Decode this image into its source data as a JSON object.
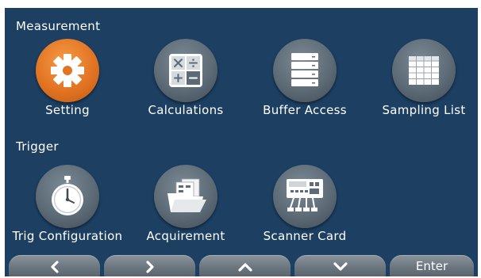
{
  "sections": {
    "measurement": "Measurement",
    "trigger": "Trigger"
  },
  "tiles": {
    "setting": {
      "label": "Setting",
      "icon": "gear-icon"
    },
    "calculations": {
      "label": "Calculations",
      "icon": "calculator-icon"
    },
    "buffer_access": {
      "label": "Buffer Access",
      "icon": "buffer-stack-icon"
    },
    "sampling_list": {
      "label": "Sampling List",
      "icon": "table-icon"
    },
    "trig_configuration": {
      "label": "Trig Configuration",
      "icon": "stopwatch-icon"
    },
    "acquirement": {
      "label": "Acquirement",
      "icon": "folder-icon"
    },
    "scanner_card": {
      "label": "Scanner Card",
      "icon": "scanner-card-icon"
    }
  },
  "navbar": {
    "left_icon": "chevron-left-icon",
    "right_icon": "chevron-right-icon",
    "up_icon": "chevron-up-icon",
    "down_icon": "chevron-down-icon",
    "enter_label": "Enter"
  },
  "colors": {
    "background": "#1c3f62",
    "active_tile": "#e27423",
    "inactive_tile": "#5d6b77",
    "button": "#6b757e"
  }
}
